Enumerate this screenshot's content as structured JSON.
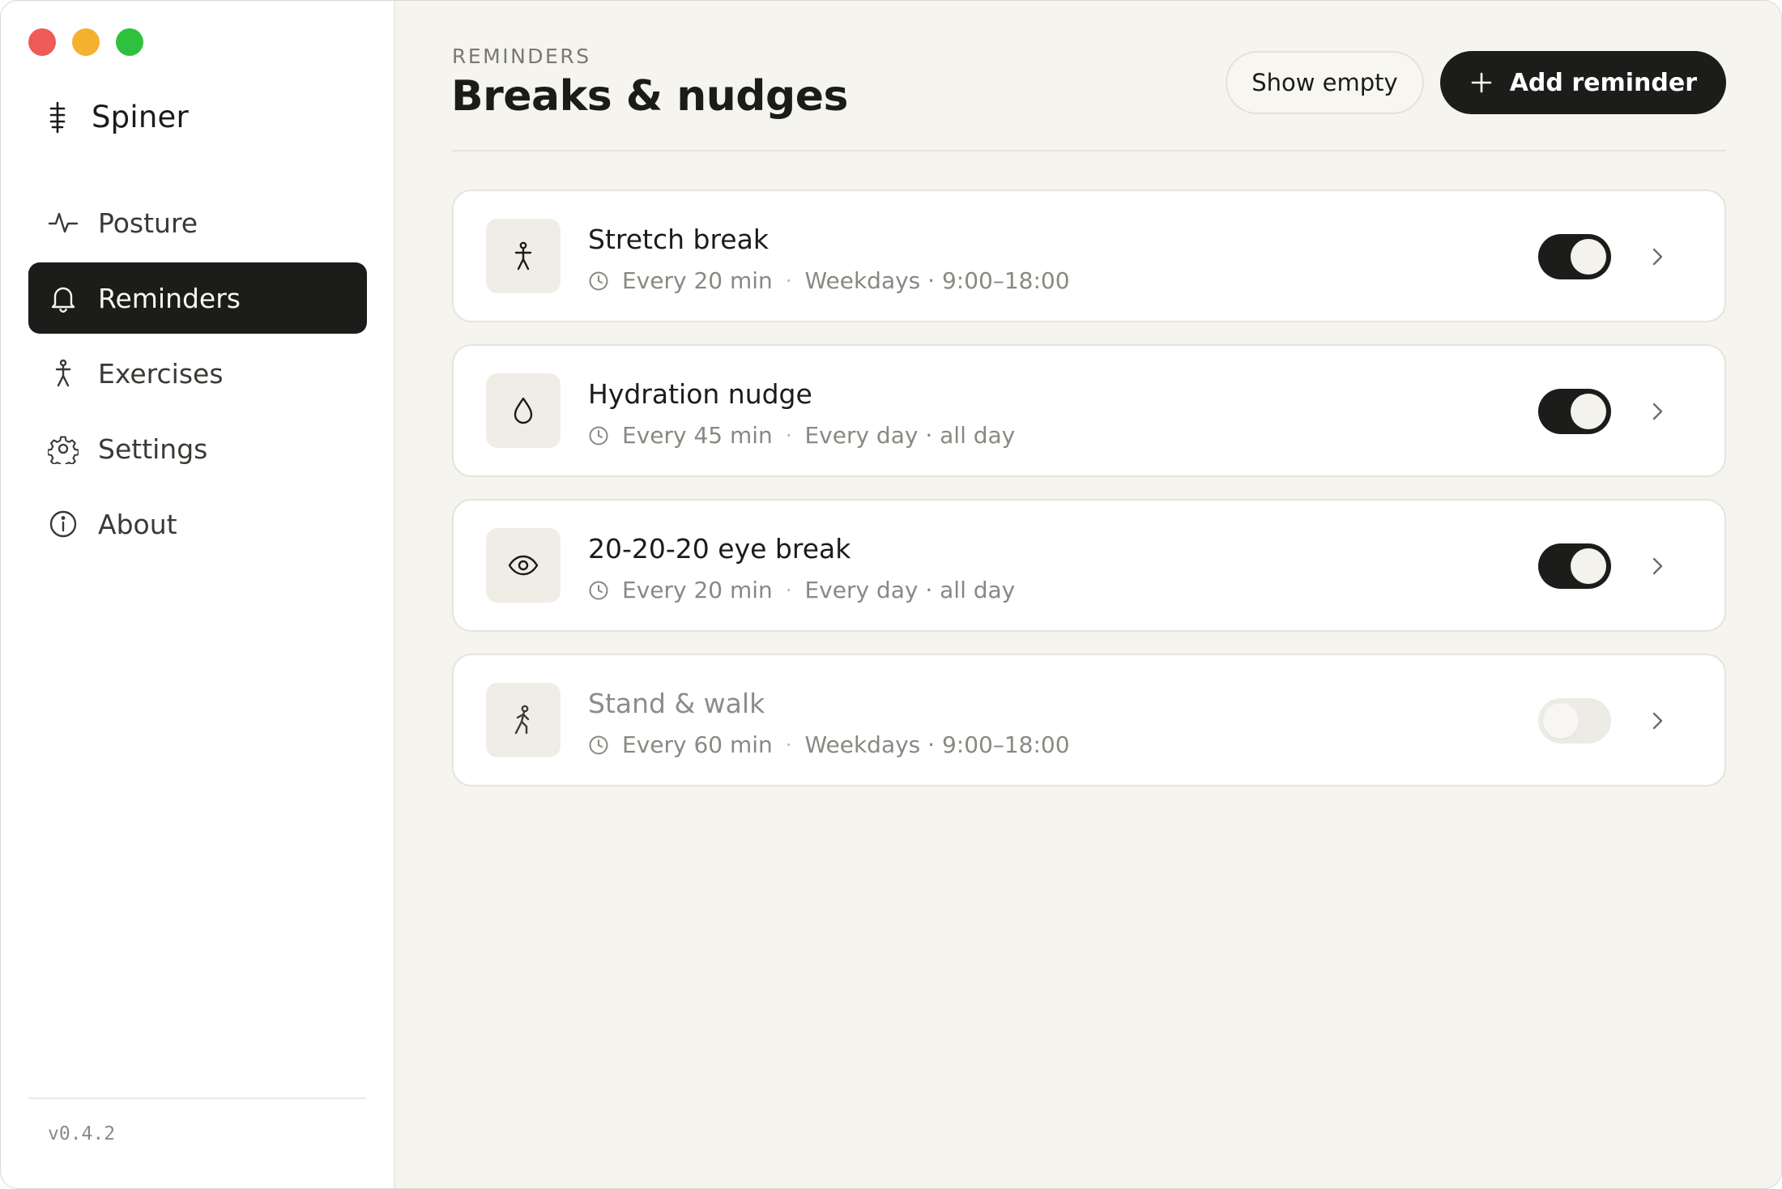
{
  "app": {
    "name": "Spiner",
    "version": "v0.4.2"
  },
  "sidebar": {
    "items": [
      {
        "label": "Posture",
        "icon": "pulse-icon",
        "active": false
      },
      {
        "label": "Reminders",
        "icon": "bell-icon",
        "active": true
      },
      {
        "label": "Exercises",
        "icon": "person-icon",
        "active": false
      },
      {
        "label": "Settings",
        "icon": "gear-icon",
        "active": false
      },
      {
        "label": "About",
        "icon": "info-icon",
        "active": false
      }
    ]
  },
  "header": {
    "eyebrow": "REMINDERS",
    "title": "Breaks & nudges",
    "show_empty_label": "Show empty",
    "add_label": "Add reminder"
  },
  "reminders": [
    {
      "title": "Stretch break",
      "interval": "Every 20 min",
      "schedule": "Weekdays · 9:00–18:00",
      "enabled": true,
      "icon": "stretch-person-icon"
    },
    {
      "title": "Hydration nudge",
      "interval": "Every 45 min",
      "schedule": "Every day · all day",
      "enabled": true,
      "icon": "water-drop-icon"
    },
    {
      "title": "20-20-20 eye break",
      "interval": "Every 20 min",
      "schedule": "Every day · all day",
      "enabled": true,
      "icon": "eye-icon"
    },
    {
      "title": "Stand & walk",
      "interval": "Every 60 min",
      "schedule": "Weekdays · 9:00–18:00",
      "enabled": false,
      "icon": "walking-person-icon"
    }
  ],
  "colors": {
    "accent": "#1c1c1a",
    "background": "#f5f4ef",
    "card": "#ffffff",
    "muted_text": "#8a8882"
  }
}
